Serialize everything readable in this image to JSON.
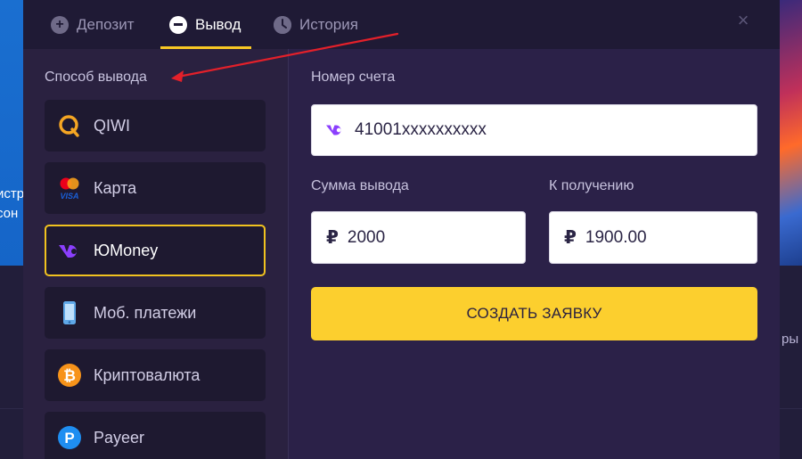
{
  "background": {
    "left_peek": [
      "истр",
      "сон"
    ],
    "right_peek": "ры"
  },
  "tabs": [
    {
      "label": "Депозит",
      "icon": "plus-circle-icon",
      "active": false
    },
    {
      "label": "Вывод",
      "icon": "minus-circle-icon",
      "active": true
    },
    {
      "label": "История",
      "icon": "clock-icon",
      "active": false
    }
  ],
  "close_icon": "close-icon",
  "methods_section": {
    "label": "Способ вывода",
    "items": [
      {
        "label": "QIWI",
        "icon": "qiwi-icon",
        "selected": false
      },
      {
        "label": "Карта",
        "icon": "card-icon",
        "selected": false
      },
      {
        "label": "ЮMoney",
        "icon": "yoomoney-icon",
        "selected": true
      },
      {
        "label": "Моб. платежи",
        "icon": "phone-icon",
        "selected": false
      },
      {
        "label": "Криптовалюта",
        "icon": "bitcoin-icon",
        "selected": false
      },
      {
        "label": "Payeer",
        "icon": "payeer-icon",
        "selected": false
      }
    ]
  },
  "form": {
    "account_label": "Номер счета",
    "account_value": "41001xxxxxxxxxx",
    "amount_label": "Сумма вывода",
    "amount_value": "2000",
    "receive_label": "К получению",
    "receive_value": "1900.00",
    "currency_symbol": "₽",
    "submit_label": "СОЗДАТЬ ЗАЯВКУ"
  },
  "colors": {
    "accent": "#f8c824",
    "modal_bg": "#2b2148",
    "tab_bar_bg": "#1f1a35",
    "annotation_arrow": "#e3202a"
  }
}
